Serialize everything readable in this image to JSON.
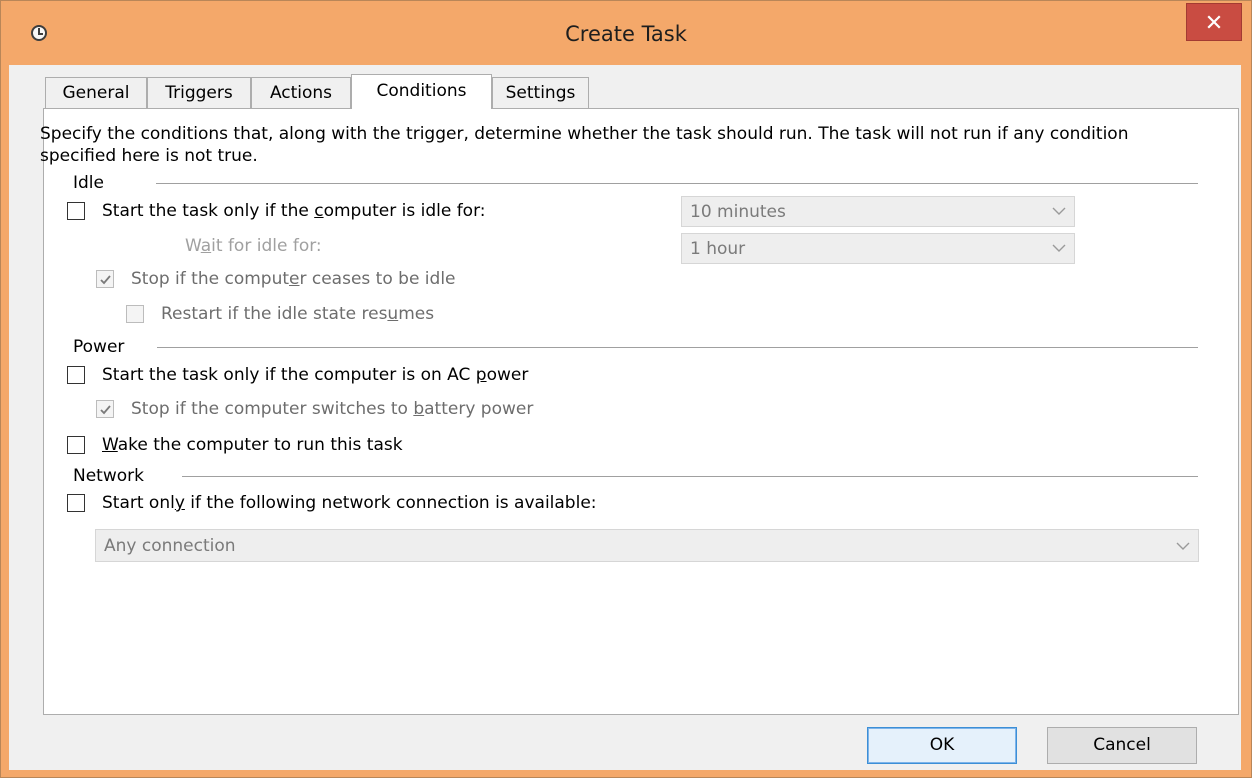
{
  "window": {
    "title": "Create Task"
  },
  "tabs": [
    {
      "label": "General"
    },
    {
      "label": "Triggers"
    },
    {
      "label": "Actions"
    },
    {
      "label": "Conditions"
    },
    {
      "label": "Settings"
    }
  ],
  "active_tab": "Conditions",
  "description": "Specify the conditions that, along with the trigger, determine whether the task should run.  The task will not run  if any condition specified here is not true.",
  "idle": {
    "title": "Idle",
    "start_if_idle": {
      "pre": "Start the task only if the ",
      "key": "c",
      "post": "omputer is idle for:",
      "checked": false
    },
    "idle_for_value": "10 minutes",
    "wait_label": {
      "pre": "W",
      "key": "a",
      "post": "it for idle for:"
    },
    "wait_value": "1 hour",
    "stop_if_ceases": {
      "pre": "Stop if the comput",
      "key": "e",
      "post": "r ceases to be idle",
      "checked": true
    },
    "restart_if_resumes": {
      "pre": "Restart if the idle state res",
      "key": "u",
      "post": "mes",
      "checked": false
    }
  },
  "power": {
    "title": "Power",
    "start_on_ac": {
      "pre": "Start the task only if the computer is on AC ",
      "key": "p",
      "post": "ower",
      "checked": false
    },
    "stop_on_battery": {
      "pre": "Stop if the computer switches to ",
      "key": "b",
      "post": "attery power",
      "checked": true
    },
    "wake": {
      "pre": "",
      "key": "W",
      "post": "ake the computer to run this task",
      "checked": false
    }
  },
  "network": {
    "title": "Network",
    "start_if_network": {
      "pre": "Start onl",
      "key": "y",
      "post": " if the following network connection is available:",
      "checked": false
    },
    "connection_value": "Any connection"
  },
  "buttons": {
    "ok": "OK",
    "cancel": "Cancel"
  },
  "colors": {
    "titlebar": "#f4a86a",
    "close": "#c94c42",
    "accent": "#3c8fd6"
  }
}
